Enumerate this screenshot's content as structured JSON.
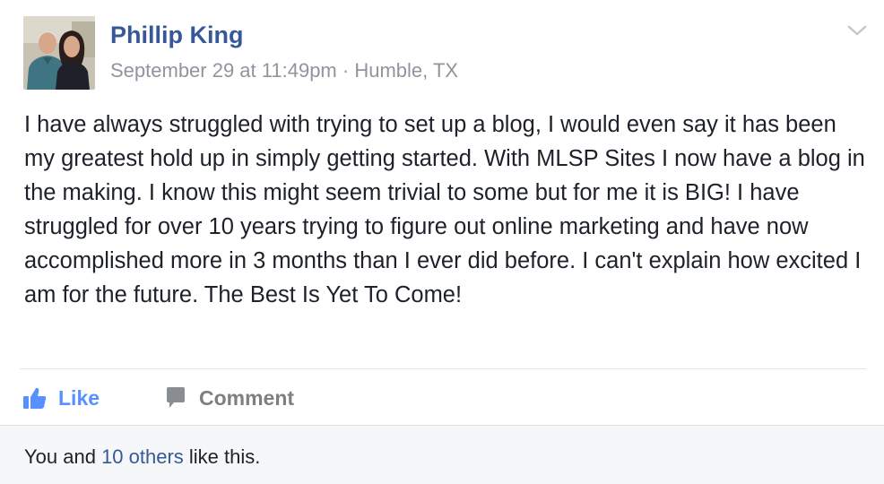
{
  "post": {
    "author": {
      "name": "Phillip King",
      "avatar_description_colors": {
        "background": "#c9c3b5",
        "person1_shirt": "#3b6f7d",
        "person2_dress": "#1e1e24"
      }
    },
    "meta": {
      "timestamp": "September 29 at 11:49pm",
      "separator": "·",
      "location": "Humble, TX"
    },
    "text": "I have always struggled with trying to set up a blog, I would even say it has been my greatest hold up in simply getting started. With MLSP Sites I now have a blog in the making. I know this might seem trivial to some but for me it is BIG! I have struggled for over 10 years trying to figure out online marketing and have now accomplished more in 3 months than I ever did before. I can't explain how excited I am for the future. The Best Is Yet To Come!",
    "actions": {
      "like_label": "Like",
      "like_icon": "thumbs-up-icon",
      "comment_label": "Comment",
      "comment_icon": "speech-bubble-icon"
    },
    "likes": {
      "prefix": "You and ",
      "others_link": "10 others",
      "suffix": " like this."
    },
    "menu_icon": "chevron-down-icon"
  },
  "colors": {
    "link_blue": "#365899",
    "like_blue": "#5890ff",
    "meta_gray": "#90949c",
    "text": "#1d2129",
    "footer_bg": "#f6f7f9"
  }
}
